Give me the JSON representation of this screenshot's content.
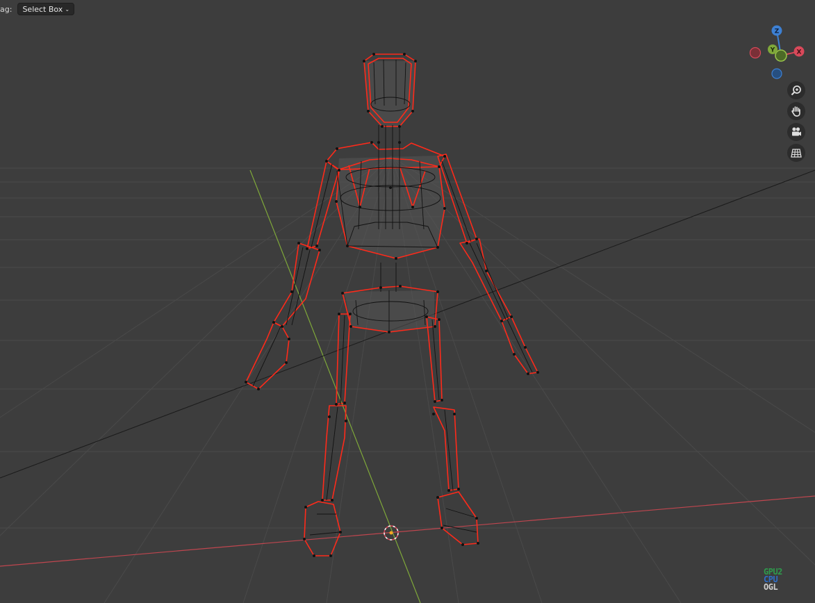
{
  "header": {
    "drag_label": "ag:",
    "drag_mode": "Select Box"
  },
  "gizmo": {
    "axes": [
      "Z",
      "Y",
      "X"
    ],
    "colors": {
      "x": "#d9495a",
      "y": "#7fa83a",
      "z": "#3d80d3"
    }
  },
  "nav_tools": [
    {
      "name": "zoom-icon"
    },
    {
      "name": "hand-icon"
    },
    {
      "name": "camera-icon"
    },
    {
      "name": "grid-icon"
    }
  ],
  "badge": {
    "lines": [
      "GPU2",
      "CPU",
      "OGL"
    ],
    "colors": [
      "#2e9a4c",
      "#2f6dc6",
      "#cfcfcf"
    ]
  },
  "colors": {
    "background": "#3d3d3d",
    "grid": "#4c4c4c",
    "x_axis": "#c0464f",
    "y_axis": "#7fa83a",
    "mesh_outline": "#ff2a1a",
    "mesh_wire": "#111111"
  }
}
